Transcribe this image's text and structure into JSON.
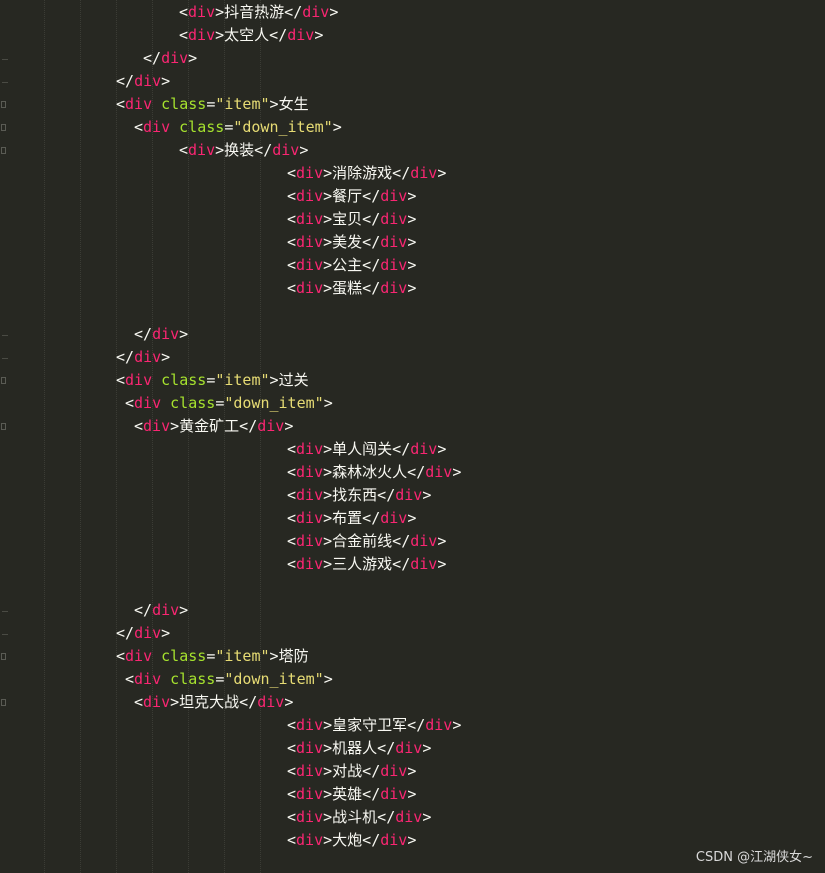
{
  "colors": {
    "background": "#272822",
    "punctuation": "#f8f8f2",
    "tag": "#f92672",
    "attribute": "#a6e22e",
    "string": "#e6db74",
    "text": "#f8f8f2"
  },
  "watermark": "CSDN @江湖侠女~",
  "lines": [
    {
      "indent": 179,
      "gutter": "none",
      "tokens": [
        [
          "p",
          "<"
        ],
        [
          "t",
          "div"
        ],
        [
          "p",
          ">"
        ],
        [
          "x",
          "抖音热游"
        ],
        [
          "p",
          "</"
        ],
        [
          "t",
          "div"
        ],
        [
          "p",
          ">"
        ]
      ]
    },
    {
      "indent": 179,
      "gutter": "none",
      "tokens": [
        [
          "p",
          "<"
        ],
        [
          "t",
          "div"
        ],
        [
          "p",
          ">"
        ],
        [
          "x",
          "太空人"
        ],
        [
          "p",
          "</"
        ],
        [
          "t",
          "div"
        ],
        [
          "p",
          ">"
        ]
      ]
    },
    {
      "indent": 143,
      "gutter": "marker",
      "tokens": [
        [
          "p",
          "</"
        ],
        [
          "t",
          "div"
        ],
        [
          "p",
          ">"
        ]
      ]
    },
    {
      "indent": 116,
      "gutter": "marker",
      "tokens": [
        [
          "p",
          "</"
        ],
        [
          "t",
          "div"
        ],
        [
          "p",
          ">"
        ]
      ]
    },
    {
      "indent": 116,
      "gutter": "fold",
      "tokens": [
        [
          "p",
          "<"
        ],
        [
          "t",
          "div"
        ],
        [
          "p",
          " "
        ],
        [
          "a",
          "class"
        ],
        [
          "p",
          "="
        ],
        [
          "s",
          "\"item\""
        ],
        [
          "p",
          ">"
        ],
        [
          "x",
          "女生"
        ]
      ]
    },
    {
      "indent": 134,
      "gutter": "fold",
      "tokens": [
        [
          "p",
          "<"
        ],
        [
          "t",
          "div"
        ],
        [
          "p",
          " "
        ],
        [
          "a",
          "class"
        ],
        [
          "p",
          "="
        ],
        [
          "s",
          "\"down_item\""
        ],
        [
          "p",
          ">"
        ]
      ]
    },
    {
      "indent": 179,
      "gutter": "fold",
      "tokens": [
        [
          "p",
          "<"
        ],
        [
          "t",
          "div"
        ],
        [
          "p",
          ">"
        ],
        [
          "x",
          "换装"
        ],
        [
          "p",
          "</"
        ],
        [
          "t",
          "div"
        ],
        [
          "p",
          ">"
        ]
      ]
    },
    {
      "indent": 287,
      "gutter": "none",
      "tokens": [
        [
          "p",
          "<"
        ],
        [
          "t",
          "div"
        ],
        [
          "p",
          ">"
        ],
        [
          "x",
          "消除游戏"
        ],
        [
          "p",
          "</"
        ],
        [
          "t",
          "div"
        ],
        [
          "p",
          ">"
        ]
      ]
    },
    {
      "indent": 287,
      "gutter": "none",
      "tokens": [
        [
          "p",
          "<"
        ],
        [
          "t",
          "div"
        ],
        [
          "p",
          ">"
        ],
        [
          "x",
          "餐厅"
        ],
        [
          "p",
          "</"
        ],
        [
          "t",
          "div"
        ],
        [
          "p",
          ">"
        ]
      ]
    },
    {
      "indent": 287,
      "gutter": "none",
      "tokens": [
        [
          "p",
          "<"
        ],
        [
          "t",
          "div"
        ],
        [
          "p",
          ">"
        ],
        [
          "x",
          "宝贝"
        ],
        [
          "p",
          "</"
        ],
        [
          "t",
          "div"
        ],
        [
          "p",
          ">"
        ]
      ]
    },
    {
      "indent": 287,
      "gutter": "none",
      "tokens": [
        [
          "p",
          "<"
        ],
        [
          "t",
          "div"
        ],
        [
          "p",
          ">"
        ],
        [
          "x",
          "美发"
        ],
        [
          "p",
          "</"
        ],
        [
          "t",
          "div"
        ],
        [
          "p",
          ">"
        ]
      ]
    },
    {
      "indent": 287,
      "gutter": "none",
      "tokens": [
        [
          "p",
          "<"
        ],
        [
          "t",
          "div"
        ],
        [
          "p",
          ">"
        ],
        [
          "x",
          "公主"
        ],
        [
          "p",
          "</"
        ],
        [
          "t",
          "div"
        ],
        [
          "p",
          ">"
        ]
      ]
    },
    {
      "indent": 287,
      "gutter": "none",
      "tokens": [
        [
          "p",
          "<"
        ],
        [
          "t",
          "div"
        ],
        [
          "p",
          ">"
        ],
        [
          "x",
          "蛋糕"
        ],
        [
          "p",
          "</"
        ],
        [
          "t",
          "div"
        ],
        [
          "p",
          ">"
        ]
      ]
    },
    {
      "indent": 0,
      "gutter": "none",
      "tokens": []
    },
    {
      "indent": 134,
      "gutter": "marker",
      "tokens": [
        [
          "p",
          "</"
        ],
        [
          "t",
          "div"
        ],
        [
          "p",
          ">"
        ]
      ]
    },
    {
      "indent": 116,
      "gutter": "marker",
      "tokens": [
        [
          "p",
          "</"
        ],
        [
          "t",
          "div"
        ],
        [
          "p",
          ">"
        ]
      ]
    },
    {
      "indent": 116,
      "gutter": "fold",
      "tokens": [
        [
          "p",
          "<"
        ],
        [
          "t",
          "div"
        ],
        [
          "p",
          " "
        ],
        [
          "a",
          "class"
        ],
        [
          "p",
          "="
        ],
        [
          "s",
          "\"item\""
        ],
        [
          "p",
          ">"
        ],
        [
          "x",
          "过关"
        ]
      ]
    },
    {
      "indent": 125,
      "gutter": "none",
      "tokens": [
        [
          "p",
          "<"
        ],
        [
          "t",
          "div"
        ],
        [
          "p",
          " "
        ],
        [
          "a",
          "class"
        ],
        [
          "p",
          "="
        ],
        [
          "s",
          "\"down_item\""
        ],
        [
          "p",
          ">"
        ]
      ]
    },
    {
      "indent": 134,
      "gutter": "fold",
      "tokens": [
        [
          "p",
          "<"
        ],
        [
          "t",
          "div"
        ],
        [
          "p",
          ">"
        ],
        [
          "x",
          "黄金矿工"
        ],
        [
          "p",
          "</"
        ],
        [
          "t",
          "div"
        ],
        [
          "p",
          ">"
        ]
      ]
    },
    {
      "indent": 287,
      "gutter": "none",
      "tokens": [
        [
          "p",
          "<"
        ],
        [
          "t",
          "div"
        ],
        [
          "p",
          ">"
        ],
        [
          "x",
          "单人闯关"
        ],
        [
          "p",
          "</"
        ],
        [
          "t",
          "div"
        ],
        [
          "p",
          ">"
        ]
      ]
    },
    {
      "indent": 287,
      "gutter": "none",
      "tokens": [
        [
          "p",
          "<"
        ],
        [
          "t",
          "div"
        ],
        [
          "p",
          ">"
        ],
        [
          "x",
          "森林冰火人"
        ],
        [
          "p",
          "</"
        ],
        [
          "t",
          "div"
        ],
        [
          "p",
          ">"
        ]
      ]
    },
    {
      "indent": 287,
      "gutter": "none",
      "tokens": [
        [
          "p",
          "<"
        ],
        [
          "t",
          "div"
        ],
        [
          "p",
          ">"
        ],
        [
          "x",
          "找东西"
        ],
        [
          "p",
          "</"
        ],
        [
          "t",
          "div"
        ],
        [
          "p",
          ">"
        ]
      ]
    },
    {
      "indent": 287,
      "gutter": "none",
      "tokens": [
        [
          "p",
          "<"
        ],
        [
          "t",
          "div"
        ],
        [
          "p",
          ">"
        ],
        [
          "x",
          "布置"
        ],
        [
          "p",
          "</"
        ],
        [
          "t",
          "div"
        ],
        [
          "p",
          ">"
        ]
      ]
    },
    {
      "indent": 287,
      "gutter": "none",
      "tokens": [
        [
          "p",
          "<"
        ],
        [
          "t",
          "div"
        ],
        [
          "p",
          ">"
        ],
        [
          "x",
          "合金前线"
        ],
        [
          "p",
          "</"
        ],
        [
          "t",
          "div"
        ],
        [
          "p",
          ">"
        ]
      ]
    },
    {
      "indent": 287,
      "gutter": "none",
      "tokens": [
        [
          "p",
          "<"
        ],
        [
          "t",
          "div"
        ],
        [
          "p",
          ">"
        ],
        [
          "x",
          "三人游戏"
        ],
        [
          "p",
          "</"
        ],
        [
          "t",
          "div"
        ],
        [
          "p",
          ">"
        ]
      ]
    },
    {
      "indent": 0,
      "gutter": "none",
      "tokens": []
    },
    {
      "indent": 134,
      "gutter": "marker",
      "tokens": [
        [
          "p",
          "</"
        ],
        [
          "t",
          "div"
        ],
        [
          "p",
          ">"
        ]
      ]
    },
    {
      "indent": 116,
      "gutter": "marker",
      "tokens": [
        [
          "p",
          "</"
        ],
        [
          "t",
          "div"
        ],
        [
          "p",
          ">"
        ]
      ]
    },
    {
      "indent": 116,
      "gutter": "fold",
      "tokens": [
        [
          "p",
          "<"
        ],
        [
          "t",
          "div"
        ],
        [
          "p",
          " "
        ],
        [
          "a",
          "class"
        ],
        [
          "p",
          "="
        ],
        [
          "s",
          "\"item\""
        ],
        [
          "p",
          ">"
        ],
        [
          "x",
          "塔防"
        ]
      ]
    },
    {
      "indent": 125,
      "gutter": "none",
      "tokens": [
        [
          "p",
          "<"
        ],
        [
          "t",
          "div"
        ],
        [
          "p",
          " "
        ],
        [
          "a",
          "class"
        ],
        [
          "p",
          "="
        ],
        [
          "s",
          "\"down_item\""
        ],
        [
          "p",
          ">"
        ]
      ]
    },
    {
      "indent": 134,
      "gutter": "fold",
      "tokens": [
        [
          "p",
          "<"
        ],
        [
          "t",
          "div"
        ],
        [
          "p",
          ">"
        ],
        [
          "x",
          "坦克大战"
        ],
        [
          "p",
          "</"
        ],
        [
          "t",
          "div"
        ],
        [
          "p",
          ">"
        ]
      ]
    },
    {
      "indent": 287,
      "gutter": "none",
      "tokens": [
        [
          "p",
          "<"
        ],
        [
          "t",
          "div"
        ],
        [
          "p",
          ">"
        ],
        [
          "x",
          "皇家守卫军"
        ],
        [
          "p",
          "</"
        ],
        [
          "t",
          "div"
        ],
        [
          "p",
          ">"
        ]
      ]
    },
    {
      "indent": 287,
      "gutter": "none",
      "tokens": [
        [
          "p",
          "<"
        ],
        [
          "t",
          "div"
        ],
        [
          "p",
          ">"
        ],
        [
          "x",
          "机器人"
        ],
        [
          "p",
          "</"
        ],
        [
          "t",
          "div"
        ],
        [
          "p",
          ">"
        ]
      ]
    },
    {
      "indent": 287,
      "gutter": "none",
      "tokens": [
        [
          "p",
          "<"
        ],
        [
          "t",
          "div"
        ],
        [
          "p",
          ">"
        ],
        [
          "x",
          "对战"
        ],
        [
          "p",
          "</"
        ],
        [
          "t",
          "div"
        ],
        [
          "p",
          ">"
        ]
      ]
    },
    {
      "indent": 287,
      "gutter": "none",
      "tokens": [
        [
          "p",
          "<"
        ],
        [
          "t",
          "div"
        ],
        [
          "p",
          ">"
        ],
        [
          "x",
          "英雄"
        ],
        [
          "p",
          "</"
        ],
        [
          "t",
          "div"
        ],
        [
          "p",
          ">"
        ]
      ]
    },
    {
      "indent": 287,
      "gutter": "none",
      "tokens": [
        [
          "p",
          "<"
        ],
        [
          "t",
          "div"
        ],
        [
          "p",
          ">"
        ],
        [
          "x",
          "战斗机"
        ],
        [
          "p",
          "</"
        ],
        [
          "t",
          "div"
        ],
        [
          "p",
          ">"
        ]
      ]
    },
    {
      "indent": 287,
      "gutter": "none",
      "tokens": [
        [
          "p",
          "<"
        ],
        [
          "t",
          "div"
        ],
        [
          "p",
          ">"
        ],
        [
          "x",
          "大炮"
        ],
        [
          "p",
          "</"
        ],
        [
          "t",
          "div"
        ],
        [
          "p",
          ">"
        ]
      ]
    }
  ]
}
